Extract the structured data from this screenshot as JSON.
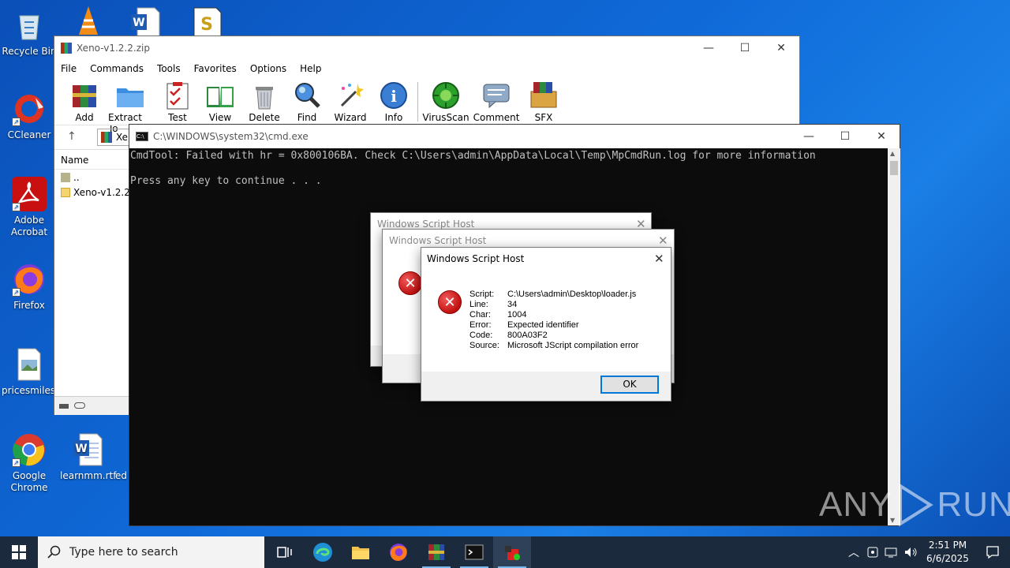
{
  "desktop": {
    "icons": [
      {
        "label": "Recycle Bin"
      },
      {
        "label": "CCleaner"
      },
      {
        "label": "Adobe Acrobat"
      },
      {
        "label": "Firefox"
      },
      {
        "label": "pricesmiles..."
      },
      {
        "label": "Google Chrome"
      },
      {
        "label": "learnmm.rtf"
      },
      {
        "label": "ed"
      }
    ]
  },
  "winrar": {
    "title": "Xeno-v1.2.2.zip",
    "menu": [
      "File",
      "Commands",
      "Tools",
      "Favorites",
      "Options",
      "Help"
    ],
    "toolbar": [
      "Add",
      "Extract To",
      "Test",
      "View",
      "Delete",
      "Find",
      "Wizard",
      "Info",
      "VirusScan",
      "Comment",
      "SFX"
    ],
    "path_text": "Xen",
    "column_name": "Name",
    "files": [
      "..",
      "Xeno-v1.2.2"
    ]
  },
  "cmd": {
    "title": "C:\\WINDOWS\\system32\\cmd.exe",
    "line1": "CmdTool: Failed with hr = 0x800106BA. Check C:\\Users\\admin\\AppData\\Local\\Temp\\MpCmdRun.log for more information",
    "line2": "Press any key to continue . . ."
  },
  "dialogs": {
    "back1_title": "Windows Script Host",
    "back2_title": "Windows Script Host",
    "front": {
      "title": "Windows Script Host",
      "rows": [
        {
          "k": "Script:",
          "v": "C:\\Users\\admin\\Desktop\\loader.js"
        },
        {
          "k": "Line:",
          "v": "34"
        },
        {
          "k": "Char:",
          "v": "1004"
        },
        {
          "k": "Error:",
          "v": "Expected identifier"
        },
        {
          "k": "Code:",
          "v": "800A03F2"
        },
        {
          "k": "Source:",
          "v": "Microsoft JScript compilation error"
        }
      ],
      "ok": "OK"
    }
  },
  "watermark": {
    "left": "ANY",
    "right": "RUN"
  },
  "taskbar": {
    "search_placeholder": "Type here to search",
    "time": "2:51 PM",
    "date": "6/6/2025"
  }
}
